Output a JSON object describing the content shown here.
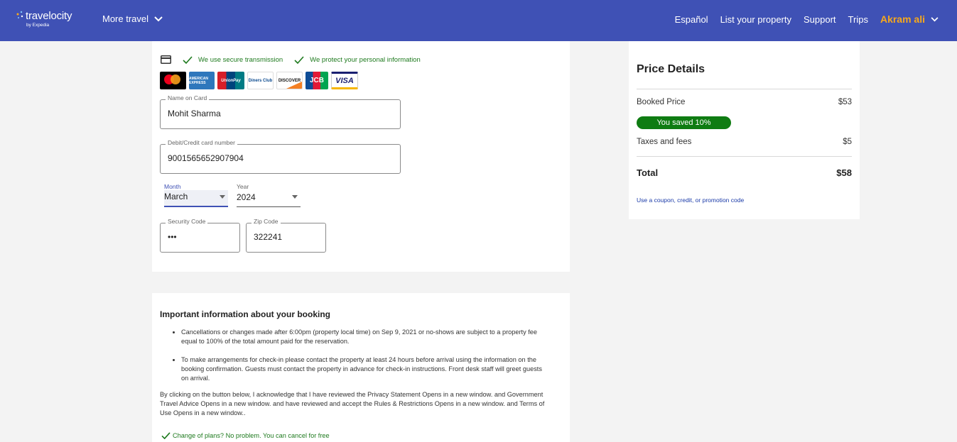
{
  "header": {
    "logo_text": "travelocity",
    "logo_sub": "by Expedia",
    "more_travel": "More travel",
    "nav": [
      "Español",
      "List your property",
      "Support",
      "Trips"
    ],
    "user": "Akram ali"
  },
  "payment": {
    "secure_transmission": "We use secure transmission",
    "protect_info": "We protect your personal information",
    "card_logos": [
      "mastercard",
      "american-express",
      "unionpay",
      "diners-club",
      "discover",
      "jcb",
      "visa"
    ],
    "card_logo_text": {
      "amex": "AMERICAN EXPRESS",
      "unionpay": "UnionPay",
      "diners": "Diners Club",
      "discover": "DISCOVER",
      "jcb": "JCB",
      "visa": "VISA"
    },
    "name_label": "Name on Card",
    "name_value": "Mohit Sharma",
    "number_label": "Debit/Credit card number",
    "number_value": "9001565652907904",
    "month_label": "Month",
    "month_value": "March",
    "year_label": "Year",
    "year_value": "2024",
    "security_label": "Security Code",
    "security_value": "•••",
    "zip_label": "Zip Code",
    "zip_value": "322241"
  },
  "info": {
    "title": "Important information about your booking",
    "bullets": [
      "Cancellations or changes made after 6:00pm (property local time) on Sep 9, 2021 or no-shows are subject to a property fee equal to 100% of the total amount paid for the reservation.",
      "To make arrangements for check-in please contact the property at least 24 hours before arrival using the information on the booking confirmation. Guests must contact the property in advance for check-in instructions. Front desk staff will greet guests on arrival."
    ],
    "acknowledgement": "By clicking on the button below, I acknowledge that I have reviewed the Privacy Statement Opens in a new window. and Government Travel Advice Opens in a new window. and have reviewed and accept the Rules & Restrictions Opens in a new window. and Terms of Use Opens in a new window..",
    "cancel_note": "Change of plans? No problem. You can cancel for free"
  },
  "price": {
    "title": "Price Details",
    "booked_label": "Booked Price",
    "booked_value": "$53",
    "saved_badge": "You saved 10%",
    "taxes_label": "Taxes and fees",
    "taxes_value": "$5",
    "total_label": "Total",
    "total_value": "$58",
    "coupon_link": "Use a coupon, credit, or promotion code"
  },
  "colors": {
    "header_bg": "#3f51b5",
    "user_accent": "#f7a81b",
    "success_green": "#0f7c12",
    "link_blue": "#1a3aa8"
  }
}
